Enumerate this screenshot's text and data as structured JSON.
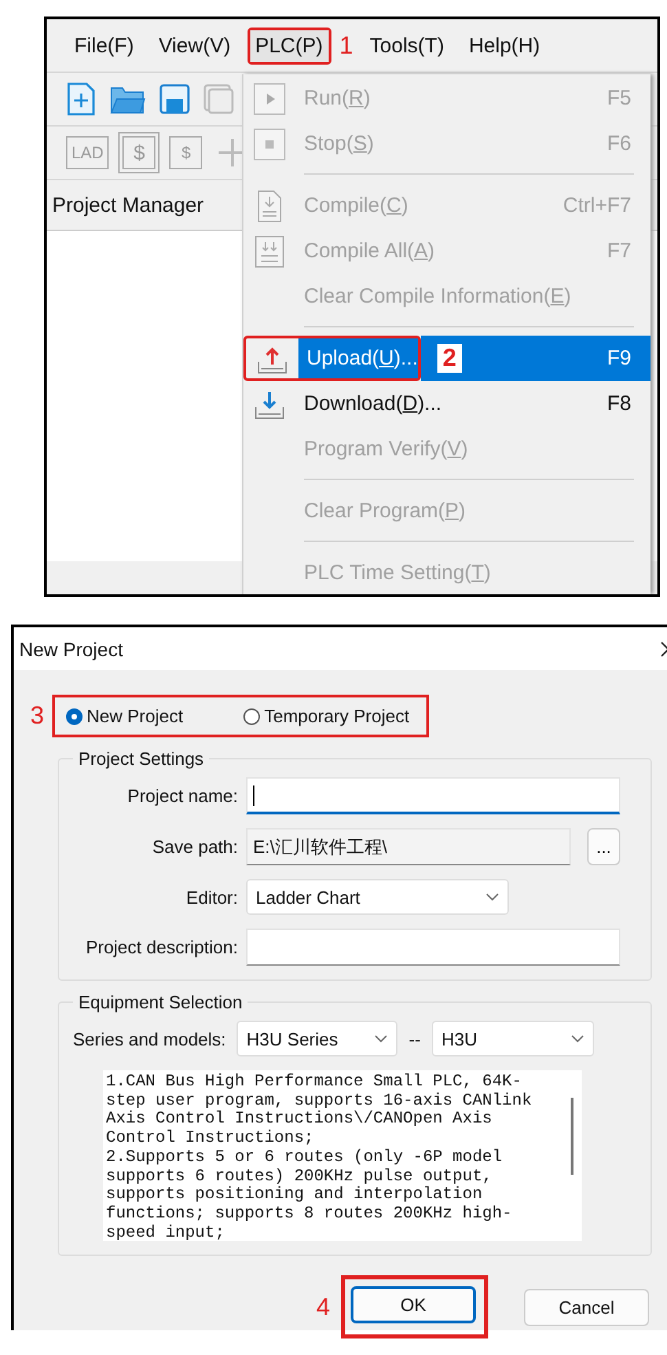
{
  "menu_window": {
    "menu_bar": [
      {
        "label": "File(F)",
        "selected": false
      },
      {
        "label": "View(V)",
        "selected": false
      },
      {
        "label": "PLC(P)",
        "selected": true,
        "annotation": "1"
      },
      {
        "label": "Tools(T)",
        "selected": false
      },
      {
        "label": "Help(H)",
        "selected": false
      }
    ],
    "toolbar_2": [
      {
        "kind": "boxed",
        "label": "LAD"
      },
      {
        "kind": "double_boxed",
        "label": "$"
      },
      {
        "kind": "boxed",
        "label": "$"
      }
    ],
    "panel_title": "Project Manager",
    "dropdown": [
      {
        "kind": "run",
        "label": "Run(R)",
        "shortcut": "F5",
        "disabled": true,
        "selected": false
      },
      {
        "kind": "stop",
        "label": "Stop(S)",
        "shortcut": "F6",
        "disabled": true,
        "selected": false
      },
      {
        "kind": "separator"
      },
      {
        "kind": "compile",
        "label": "Compile(C)",
        "shortcut": "Ctrl+F7",
        "disabled": true,
        "selected": false
      },
      {
        "kind": "compile_all",
        "label": "Compile All(A)",
        "shortcut": "F7",
        "disabled": true,
        "selected": false
      },
      {
        "kind": "plain",
        "label": "Clear Compile Information(E)",
        "disabled": true,
        "selected": false
      },
      {
        "kind": "separator"
      },
      {
        "kind": "upload",
        "label": "Upload(U)...",
        "shortcut": "F9",
        "disabled": false,
        "selected": true,
        "annotation": "2"
      },
      {
        "kind": "download",
        "label": "Download(D)...",
        "shortcut": "F8",
        "disabled": false,
        "selected": false
      },
      {
        "kind": "plain",
        "label": "Program Verify(V)",
        "disabled": true,
        "selected": false
      },
      {
        "kind": "separator"
      },
      {
        "kind": "plain",
        "label": "Clear Program(P)",
        "disabled": true,
        "selected": false
      },
      {
        "kind": "separator"
      },
      {
        "kind": "plain",
        "label": "PLC Time Setting(T)",
        "disabled": true,
        "selected": false
      }
    ]
  },
  "dialog": {
    "title": "New Project",
    "mode_annotation": "3",
    "mode_options": [
      {
        "label": "New Project",
        "selected": true
      },
      {
        "label": "Temporary Project",
        "selected": false
      }
    ],
    "project_settings": {
      "title": "Project Settings",
      "fields": [
        {
          "kind": "text",
          "label": "Project name:",
          "focused": true
        },
        {
          "kind": "path",
          "label": "Save path:",
          "value": "E:\\汇川软件工程\\",
          "button": "..."
        },
        {
          "kind": "select",
          "label": "Editor:",
          "value": "Ladder Chart"
        },
        {
          "kind": "text",
          "label": "Project description:",
          "focused": false
        }
      ]
    },
    "equipment_selection": {
      "title": "Equipment Selection",
      "label": "Series and models:",
      "series": "H3U Series",
      "separator": "--",
      "model": "H3U",
      "description": [
        "1.CAN Bus High Performance Small PLC, 64K-",
        "step user program, supports 16-axis CANlink",
        "Axis Control Instructions\\/CANOpen Axis",
        "Control Instructions;",
        "2.Supports 5 or 6 routes (only -6P model",
        "supports 6 routes) 200KHz pulse output,",
        "supports positioning and interpolation",
        "functions; supports 8 routes 200KHz high-",
        "speed input;"
      ]
    },
    "buttons": [
      {
        "label": "OK",
        "kind": "default",
        "annotation": "4"
      },
      {
        "label": "Cancel",
        "kind": "normal"
      }
    ]
  }
}
